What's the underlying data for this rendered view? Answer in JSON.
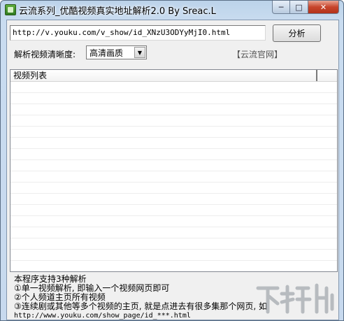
{
  "window": {
    "title": "云流系列_优酷视频真实地址解析2.0  By Sreac.L",
    "min_glyph": "─",
    "max_glyph": "□",
    "close_glyph": "✕"
  },
  "toolbar": {
    "url_value": "http://v.youku.com/v_show/id_XNzU3ODYyMjI0.html",
    "analyze_label": "分析"
  },
  "quality": {
    "label": "解析视频清晰度:",
    "selected": "高清画质"
  },
  "official_link": "【云流官网】",
  "list": {
    "column_header": "视频列表"
  },
  "help": {
    "intro": "本程序支持3种解析",
    "line1": "①单一视频解析, 即输入一个视频网页即可",
    "line2": "②个人频道主页所有视频",
    "line3": "③连续剧或其他等多个视频的主页, 就是点进去有很多集那个网页, 如",
    "example": "http://www.youku.com/show_page/id_***.html"
  },
  "watermark_text": "下载吧"
}
